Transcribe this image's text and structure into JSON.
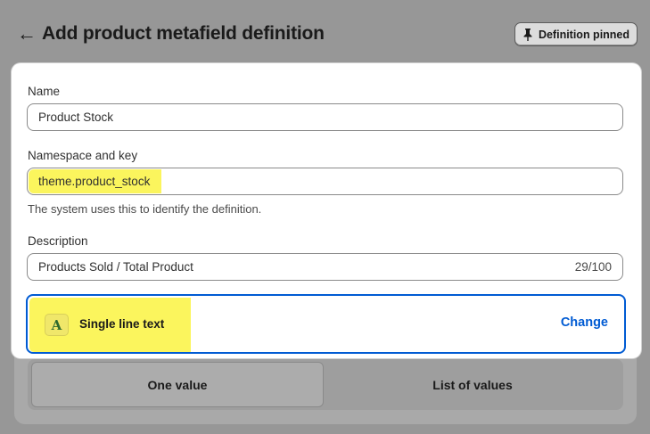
{
  "header": {
    "back_icon": "arrow-left-icon",
    "title": "Add product metafield definition",
    "pinned_button": {
      "label": "Definition pinned",
      "icon": "pin-icon"
    }
  },
  "form": {
    "name": {
      "label": "Name",
      "value": "Product Stock"
    },
    "namespace": {
      "label": "Namespace and key",
      "value": "theme.product_stock",
      "help": "The system uses this to identify the definition."
    },
    "description": {
      "label": "Description",
      "value": "Products Sold / Total Product",
      "counter": "29/100"
    },
    "type": {
      "icon_letter": "A",
      "label": "Single line text",
      "change_label": "Change"
    }
  },
  "value_toggle": {
    "options": [
      "One value",
      "List of values"
    ],
    "selected": "One value"
  },
  "colors": {
    "accent": "#005bd3",
    "highlight": "#fbf55d",
    "overlay": "#979797"
  }
}
